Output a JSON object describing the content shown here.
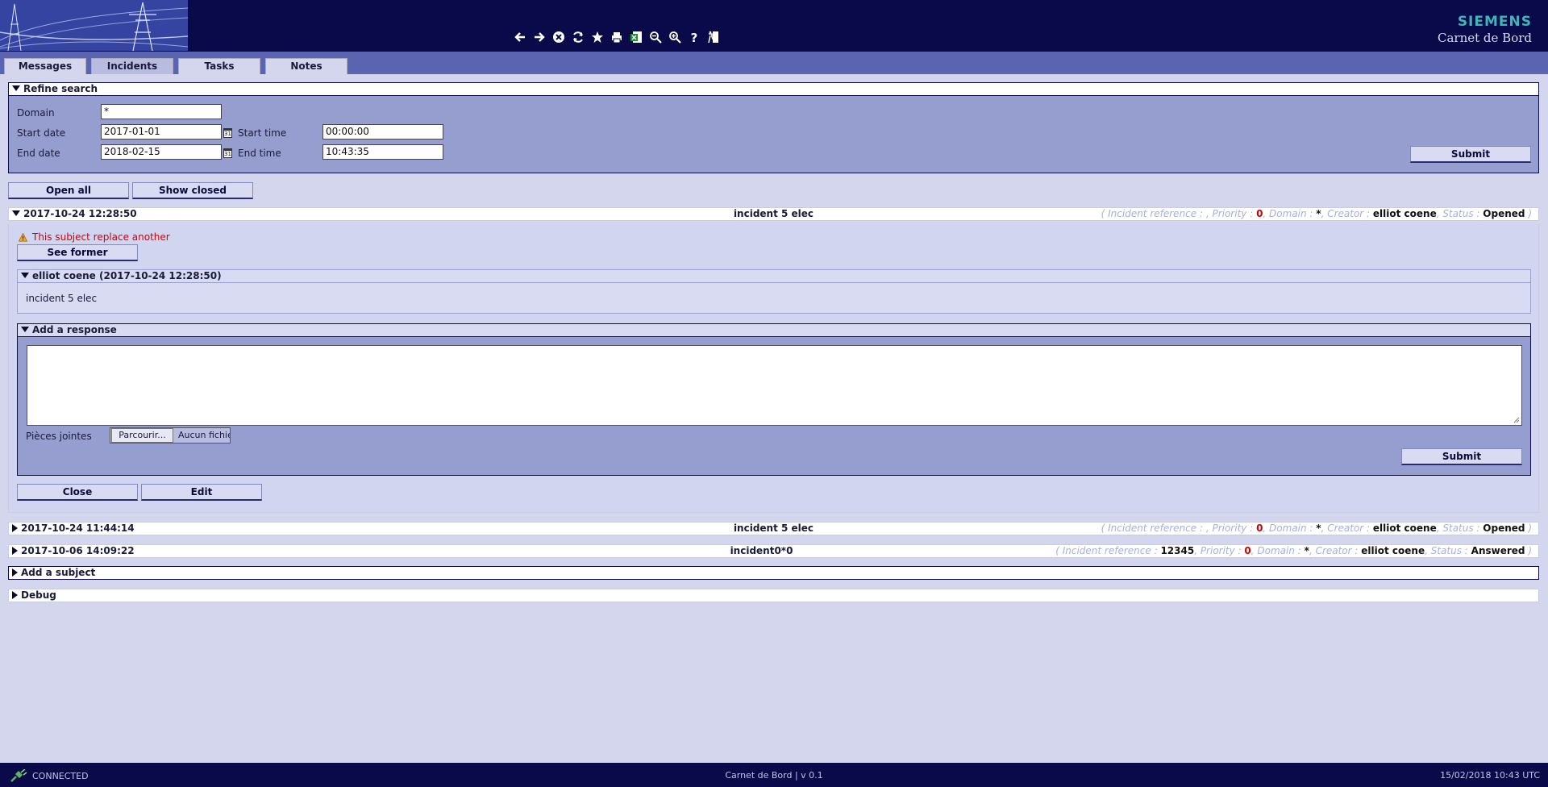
{
  "header": {
    "brand": "SIEMENS",
    "app_title": "Carnet de Bord",
    "toolbar": [
      "back-icon",
      "forward-icon",
      "stop-icon",
      "refresh-icon",
      "favorite-icon",
      "print-icon",
      "export-excel-icon",
      "zoom-out-icon",
      "zoom-in-icon",
      "help-icon",
      "exit-icon"
    ]
  },
  "tabs": [
    {
      "label": "Messages"
    },
    {
      "label": "Incidents"
    },
    {
      "label": "Tasks"
    },
    {
      "label": "Notes"
    }
  ],
  "refine": {
    "title": "Refine search",
    "domain_label": "Domain",
    "domain_value": "*",
    "start_date_label": "Start date",
    "start_date_value": "2017-01-01",
    "start_time_label": "Start time",
    "start_time_value": "00:00:00",
    "end_date_label": "End date",
    "end_date_value": "2018-02-15",
    "end_time_label": "End time",
    "end_time_value": "10:43:35",
    "calendar_icon_text": "31",
    "submit_label": "Submit"
  },
  "actions": {
    "open_all": "Open all",
    "show_closed": "Show closed"
  },
  "meta_keys": {
    "open": "( Incident reference : ",
    "priority": ", Priority : ",
    "domain": ", Domain : ",
    "creator": ", Creator : ",
    "status": ", Status : ",
    "close": " )"
  },
  "subjects": [
    {
      "date": "2017-10-24 12:28:50",
      "title": "incident 5 elec",
      "reference": "",
      "priority": "0",
      "domain": "*",
      "creator": "elliot coene",
      "status": "Opened"
    },
    {
      "date": "2017-10-24 11:44:14",
      "title": "incident 5 elec",
      "reference": "",
      "priority": "0",
      "domain": "*",
      "creator": "elliot coene",
      "status": "Opened"
    },
    {
      "date": "2017-10-06 14:09:22",
      "title": "incident0*0",
      "reference": "12345",
      "priority": "0",
      "domain": "*",
      "creator": "elliot coene",
      "status": "Answered"
    }
  ],
  "detail": {
    "warning": "This subject replace another",
    "see_former": "See former",
    "response_header": "elliot coene (2017-10-24 12:28:50)",
    "response_body": "incident 5 elec",
    "add_response_title": "Add a response",
    "attachments_label": "Pièces jointes",
    "browse_label": "Parcourir...",
    "no_file_label": "Aucun fichier sélectionné.",
    "submit_label": "Submit",
    "close_label": "Close",
    "edit_label": "Edit"
  },
  "sections": {
    "add_subject": "Add a subject",
    "debug": "Debug"
  },
  "statusbar": {
    "connection": "CONNECTED",
    "app_version": "Carnet de Bord | v 0.1",
    "datetime": "15/02/2018 10:43 UTC"
  },
  "colors": {
    "header_bg": "#0a0a4a",
    "brand_accent": "#3ab8b8",
    "panel_bg": "#959ecf",
    "page_bg": "#d4d6ee",
    "warning_red": "#d40000"
  }
}
